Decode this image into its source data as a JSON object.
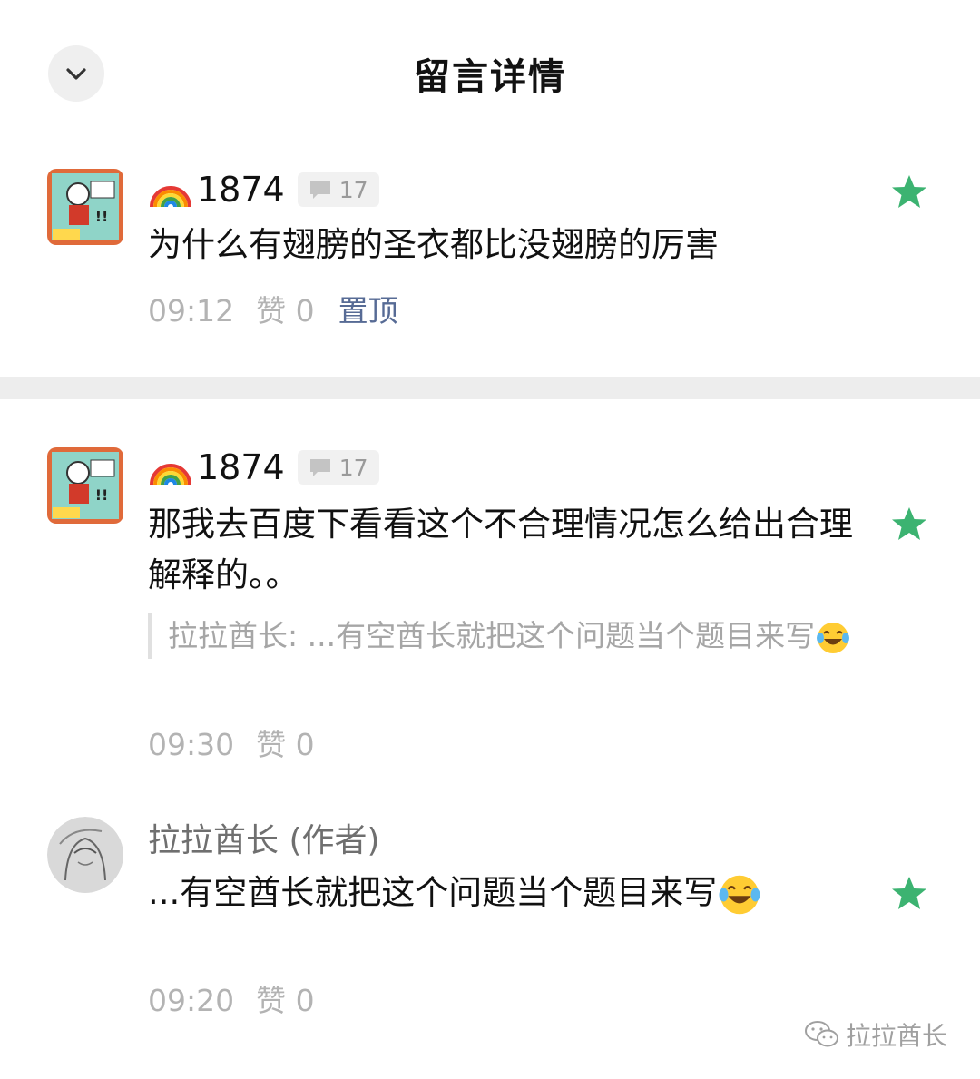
{
  "header": {
    "title": "留言详情",
    "back_icon": "chevron-down-icon"
  },
  "comments": [
    {
      "user": "1874",
      "user_prefix_icon": "rainbow-emoji",
      "badge_count": "17",
      "text": "为什么有翅膀的圣衣都比没翅膀的厉害",
      "time": "09:12",
      "likes": "赞 0",
      "pin_label": "置顶"
    },
    {
      "user": "1874",
      "user_prefix_icon": "rainbow-emoji",
      "badge_count": "17",
      "text": "那我去百度下看看这个不合理情况怎么给出合理解释的。。",
      "quote": "拉拉酋长: ...有空酋长就把这个问题当个题目来写",
      "time": "09:30",
      "likes": "赞 0"
    },
    {
      "user": "拉拉酋长 (作者)",
      "text": "...有空酋长就把这个问题当个题目来写",
      "time": "09:20",
      "likes": "赞 0"
    }
  ],
  "watermark": {
    "label": "拉拉酋长",
    "icon": "wechat-icon"
  },
  "colors": {
    "star": "#3cb371",
    "link": "#576b95",
    "meta": "#b3b3b3",
    "divider": "#ededed"
  }
}
